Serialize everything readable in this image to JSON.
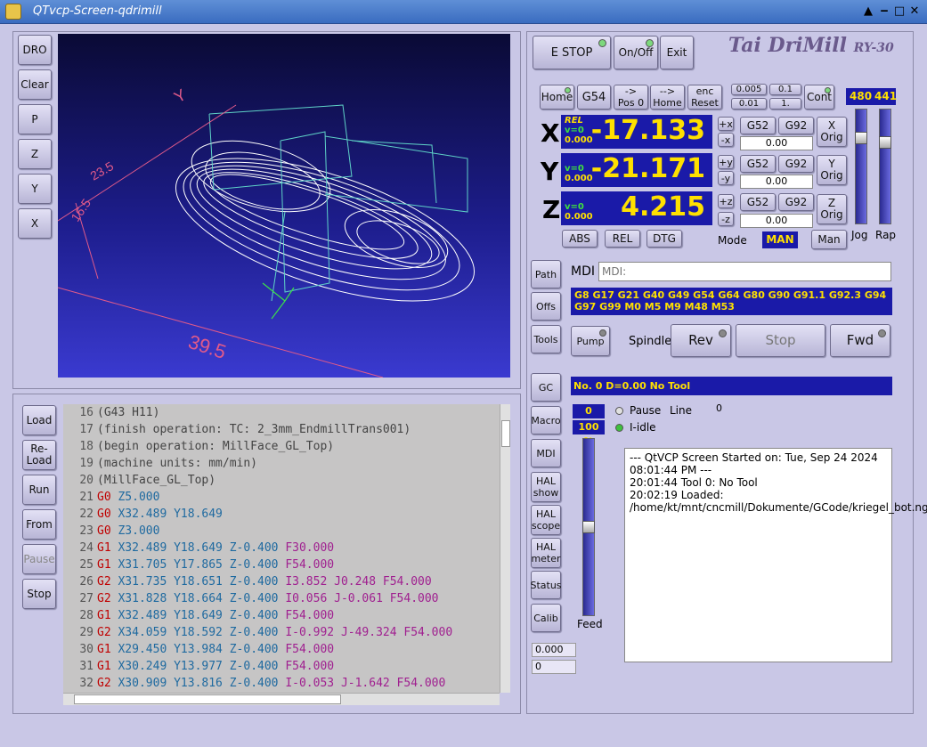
{
  "window": {
    "title": "QTvcp-Screen-qdrimill",
    "controls": [
      "▲",
      "‒",
      "□",
      "✕"
    ]
  },
  "left_buttons": [
    "DRO",
    "Clear",
    "P",
    "Z",
    "Y",
    "X"
  ],
  "preview": {
    "dim_x": "39.5",
    "dim_y": "16.5",
    "dim_z": "23.5",
    "axis_label": "Y"
  },
  "file_buttons": [
    "Load",
    "Re-\nLoad",
    "Run",
    "From",
    "Pause",
    "Stop"
  ],
  "gcode": [
    {
      "n": "16",
      "parts": [
        [
          "cmt",
          "(G43 H11)"
        ]
      ]
    },
    {
      "n": "17",
      "parts": [
        [
          "cmt",
          "(finish operation: TC: 2_3mm_EndmillTrans001)"
        ]
      ]
    },
    {
      "n": "18",
      "parts": [
        [
          "cmt",
          "(begin operation: MillFace_GL_Top)"
        ]
      ]
    },
    {
      "n": "19",
      "parts": [
        [
          "cmt",
          "(machine units: mm/min)"
        ]
      ]
    },
    {
      "n": "20",
      "parts": [
        [
          "cmt",
          "(MillFace_GL_Top)"
        ]
      ]
    },
    {
      "n": "21",
      "parts": [
        [
          "gw",
          "G0"
        ],
        [
          "ax",
          " Z5.000"
        ]
      ]
    },
    {
      "n": "22",
      "parts": [
        [
          "gw",
          "G0"
        ],
        [
          "ax",
          " X32.489 Y18.649"
        ]
      ]
    },
    {
      "n": "23",
      "parts": [
        [
          "gw",
          "G0"
        ],
        [
          "ax",
          " Z3.000"
        ]
      ]
    },
    {
      "n": "24",
      "parts": [
        [
          "gw",
          "G1"
        ],
        [
          "ax",
          " X32.489 Y18.649 Z-0.400"
        ],
        [
          "fw",
          " F30.000"
        ]
      ]
    },
    {
      "n": "25",
      "parts": [
        [
          "gw",
          "G1"
        ],
        [
          "ax",
          " X31.705 Y17.865 Z-0.400"
        ],
        [
          "fw",
          " F54.000"
        ]
      ]
    },
    {
      "n": "26",
      "parts": [
        [
          "gw",
          "G2"
        ],
        [
          "ax",
          " X31.735 Y18.651 Z-0.400"
        ],
        [
          "fw",
          " I3.852 J0.248 F54.000"
        ]
      ]
    },
    {
      "n": "27",
      "parts": [
        [
          "gw",
          "G2"
        ],
        [
          "ax",
          " X31.828 Y18.664 Z-0.400"
        ],
        [
          "fw",
          " I0.056 J-0.061 F54.000"
        ]
      ]
    },
    {
      "n": "28",
      "parts": [
        [
          "gw",
          "G1"
        ],
        [
          "ax",
          " X32.489 Y18.649 Z-0.400"
        ],
        [
          "fw",
          " F54.000"
        ]
      ]
    },
    {
      "n": "29",
      "parts": [
        [
          "gw",
          "G2"
        ],
        [
          "ax",
          " X34.059 Y18.592 Z-0.400"
        ],
        [
          "fw",
          " I-0.992 J-49.324 F54.000"
        ]
      ]
    },
    {
      "n": "30",
      "parts": [
        [
          "gw",
          "G1"
        ],
        [
          "ax",
          " X29.450 Y13.984 Z-0.400"
        ],
        [
          "fw",
          " F54.000"
        ]
      ]
    },
    {
      "n": "31",
      "parts": [
        [
          "gw",
          "G1"
        ],
        [
          "ax",
          " X30.249 Y13.977 Z-0.400"
        ],
        [
          "fw",
          " F54.000"
        ]
      ]
    },
    {
      "n": "32",
      "parts": [
        [
          "gw",
          "G2"
        ],
        [
          "ax",
          " X30.909 Y13.816 Z-0.400"
        ],
        [
          "fw",
          " I-0.053 J-1.642 F54.000"
        ]
      ]
    }
  ],
  "top": {
    "estop": "E STOP",
    "onoff": "On/Off",
    "exit": "Exit",
    "brand": "Tai DriMill",
    "model": "RY-30"
  },
  "homing": {
    "home": "Home",
    "g54": "G54",
    "pos0": "->\nPos 0",
    "tohome": "-->\nHome",
    "encreset": "enc\nReset",
    "inc": [
      "0.005",
      "0.1",
      "0.01",
      "1."
    ],
    "cont": "Cont",
    "jog_val": "480",
    "rap_val": "441"
  },
  "dro": {
    "x": {
      "axis": "X",
      "value": "-17.133",
      "rel": "REL",
      "v": "v=0",
      "sub": "0.000",
      "plus": "+x",
      "minus": "-x",
      "offset": "0.00",
      "orig": "X\nOrig"
    },
    "y": {
      "axis": "Y",
      "value": "-21.171",
      "v": "v=0",
      "sub": "0.000",
      "plus": "+y",
      "minus": "-y",
      "offset": "0.00",
      "orig": "Y\nOrig"
    },
    "z": {
      "axis": "Z",
      "value": "4.215",
      "v": "v=0",
      "sub": "0.000",
      "plus": "+z",
      "minus": "-z",
      "offset": "0.00",
      "orig": "Z\nOrig"
    },
    "g52": "G52",
    "g92": "G92"
  },
  "mode_row": {
    "abs": "ABS",
    "rel": "REL",
    "dtg": "DTG",
    "mode": "Mode",
    "man_active": "MAN",
    "man": "Man",
    "jog": "Jog",
    "rap": "Rap"
  },
  "right_tabs": [
    "Path",
    "Offs",
    "Tools",
    "GC",
    "Macro",
    "MDI",
    "HAL\nshow",
    "HAL\nscope",
    "HAL\nmeter",
    "Status",
    "Calib"
  ],
  "mdi": {
    "label": "MDI",
    "placeholder": "MDI:",
    "gcodes": "G8 G17 G21 G40 G49 G54 G64 G80 G90 G91.1 G92.3 G94 G97 G99 M0 M5 M9 M48 M53"
  },
  "spindle": {
    "pump": "Pump",
    "label": "Spindle",
    "rev": "Rev",
    "stop": "Stop",
    "fwd": "Fwd"
  },
  "tool": {
    "info": "No. 0   D=0.00   No Tool"
  },
  "status": {
    "line_num": "0",
    "feed_pct": "100 %",
    "pause": "Pause",
    "line": "Line",
    "line_val": "0",
    "idle": "I-idle",
    "feed": "Feed",
    "val1": "0.000",
    "val2": "0"
  },
  "console": [
    "--- QtVCP Screen Started on: Tue, Sep 24 2024 08:01:44 PM ---",
    "20:01:44 Tool 0: No Tool",
    "20:02:19 Loaded: /home/kt/mnt/cncmill/Dokumente/GCode/kriegel_bot.ngc"
  ],
  "colors": {
    "dro_bg": "#1a1aa8",
    "dro_text": "#ffe000",
    "brand": "#6a5a8c"
  }
}
